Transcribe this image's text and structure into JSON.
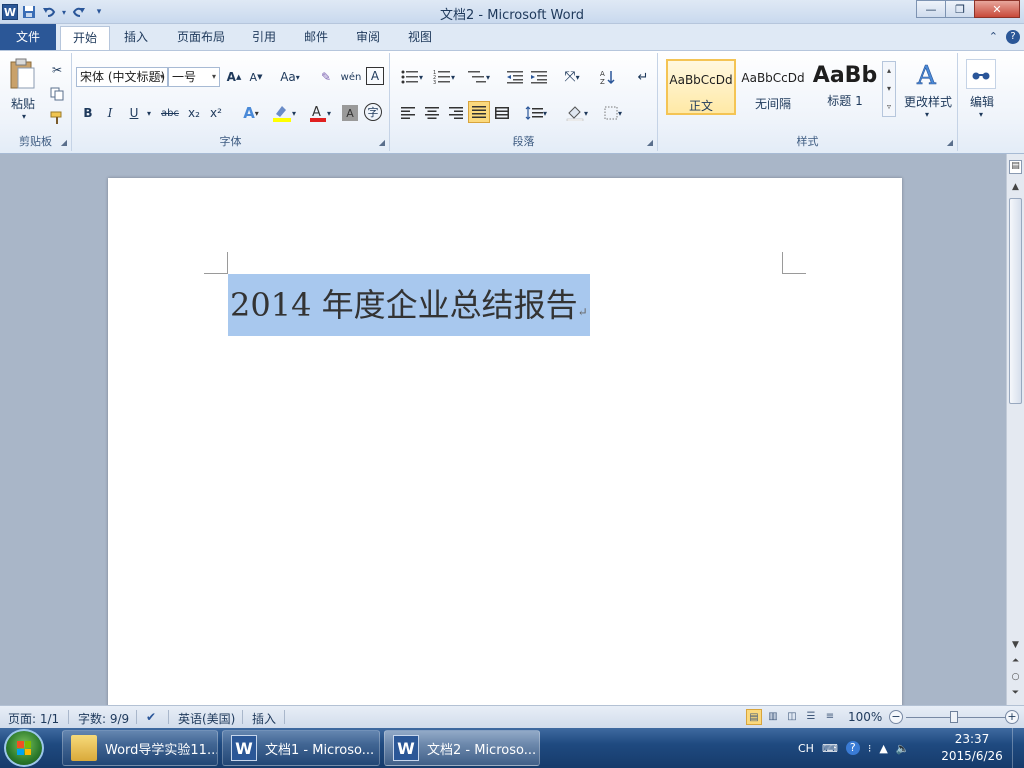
{
  "window": {
    "title": "文档2 - Microsoft Word",
    "app_icon": "W",
    "qat": {
      "save": "save-icon",
      "undo": "undo-icon",
      "redo": "redo-icon",
      "customize": "customize-qat-icon"
    },
    "controls": {
      "minimize": "—",
      "maximize": "❐",
      "close": "✕"
    }
  },
  "ribbon_tabs": [
    "文件",
    "开始",
    "插入",
    "页面布局",
    "引用",
    "邮件",
    "审阅",
    "视图"
  ],
  "ribbon": {
    "clipboard": {
      "label": "剪贴板",
      "paste": "粘贴"
    },
    "font": {
      "label": "字体",
      "font_name": "宋体 (中文标题)",
      "font_size": "一号",
      "bold": "B",
      "italic": "I",
      "underline": "U",
      "strike": "abc",
      "sub": "x₂",
      "sup": "x²",
      "grow": "A",
      "shrink": "A",
      "case": "Aa",
      "clear": "A"
    },
    "paragraph": {
      "label": "段落"
    },
    "styles": {
      "label": "样式",
      "tiles": [
        {
          "preview": "AaBbCcDd",
          "name": "正文"
        },
        {
          "preview": "AaBbCcDd",
          "name": "无间隔"
        },
        {
          "preview": "AaBb",
          "name": "标题 1"
        }
      ],
      "change_styles": "更改样式"
    },
    "editing": {
      "label": "编辑"
    }
  },
  "document": {
    "text": "2014 年度企业总结报告",
    "paragraph_mark": "↵",
    "selection_color": "#a8c8ee"
  },
  "status_bar": {
    "page": "页面: 1/1",
    "words": "字数: 9/9",
    "language": "英语(美国)",
    "mode": "插入",
    "zoom": "100%",
    "zoom_minus": "−",
    "zoom_plus": "+"
  },
  "taskbar": {
    "items": [
      {
        "label": "Word导学实验11...",
        "icon": "folder-icon"
      },
      {
        "label": "文档1 - Microso...",
        "icon": "word-icon"
      },
      {
        "label": "文档2 - Microso...",
        "icon": "word-icon"
      }
    ],
    "tray": {
      "ime": "CH"
    },
    "clock": {
      "time": "23:37",
      "date": "2015/6/26"
    }
  },
  "colors": {
    "word_blue": "#2b5797",
    "ribbon_bg": "#dfe9f5",
    "selected_style": "#f4c454"
  }
}
